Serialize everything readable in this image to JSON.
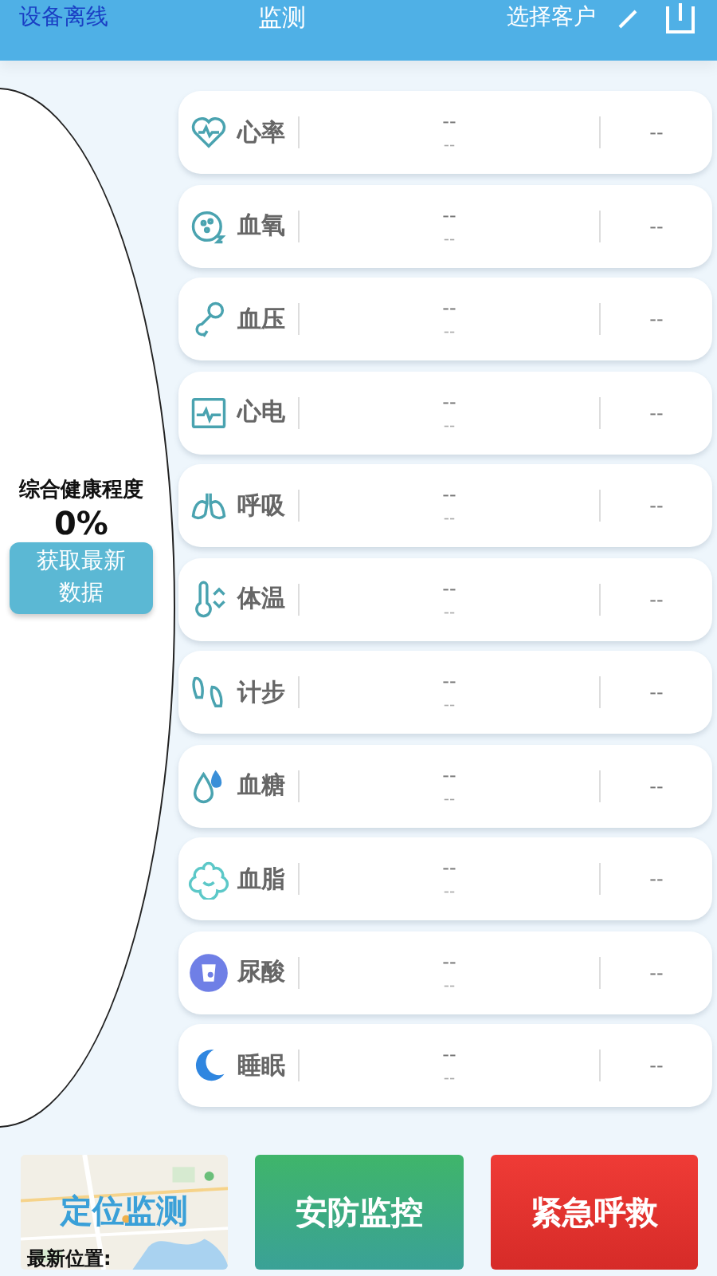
{
  "header": {
    "status": "设备离线",
    "title": "监测",
    "customer_select": "选择客户"
  },
  "summary": {
    "label": "综合健康程度",
    "value": "0%",
    "refresh_button": "获取最新数据"
  },
  "metrics": [
    {
      "kind": "heart",
      "name": "心率",
      "value": "--",
      "sub": "--",
      "reading": "--"
    },
    {
      "kind": "oxygen",
      "name": "血氧",
      "value": "--",
      "sub": "--",
      "reading": "--"
    },
    {
      "kind": "pressure",
      "name": "血压",
      "value": "--",
      "sub": "--",
      "reading": "--"
    },
    {
      "kind": "ecg",
      "name": "心电",
      "value": "--",
      "sub": "--",
      "reading": "--"
    },
    {
      "kind": "lungs",
      "name": "呼吸",
      "value": "--",
      "sub": "--",
      "reading": "--"
    },
    {
      "kind": "temperature",
      "name": "体温",
      "value": "--",
      "sub": "--",
      "reading": "--"
    },
    {
      "kind": "steps",
      "name": "计步",
      "value": "--",
      "sub": "--",
      "reading": "--"
    },
    {
      "kind": "glucose",
      "name": "血糖",
      "value": "--",
      "sub": "--",
      "reading": "--"
    },
    {
      "kind": "lipid",
      "name": "血脂",
      "value": "--",
      "sub": "--",
      "reading": "--"
    },
    {
      "kind": "uric",
      "name": "尿酸",
      "value": "--",
      "sub": "--",
      "reading": "--"
    },
    {
      "kind": "sleep",
      "name": "睡眠",
      "value": "--",
      "sub": "--",
      "reading": "--"
    }
  ],
  "actions": [
    {
      "kind": "map",
      "label": "定位监测",
      "sub": "最新位置:"
    },
    {
      "kind": "security",
      "label": "安防监控"
    },
    {
      "kind": "emergency",
      "label": "紧急呼救"
    }
  ]
}
